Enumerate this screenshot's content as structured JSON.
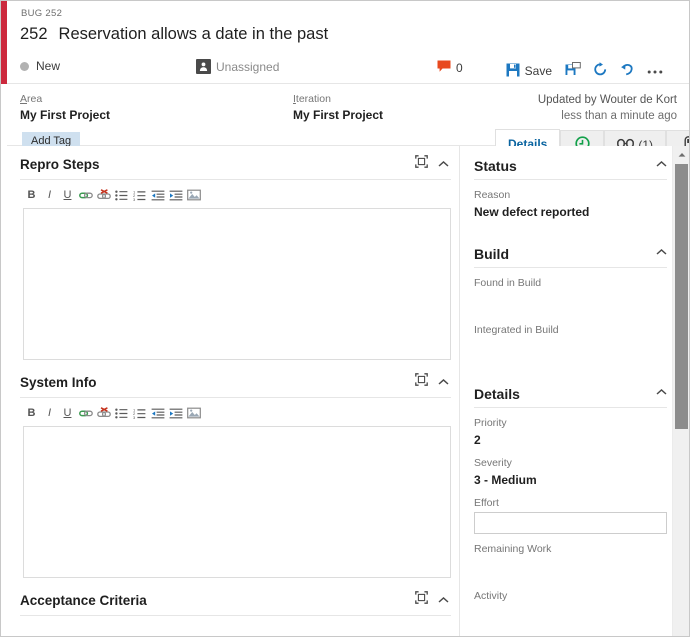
{
  "window": {
    "close_label": "×",
    "accent_color": "#cc293d"
  },
  "header": {
    "breadcrumb": "BUG 252",
    "work_item_id": "252",
    "title": "Reservation allows a date in the past",
    "state": "New",
    "assigned_to": "Unassigned",
    "discussion_count": "0",
    "toolbar": {
      "save_label": "Save",
      "save_and_close_name": "save-and-close-icon",
      "refresh_name": "refresh-icon",
      "revert_name": "undo-icon",
      "more_label": "…"
    }
  },
  "classification": {
    "area_label": "Area",
    "area_accesskey": "A",
    "area_value": "My First Project",
    "iteration_label": "Iteration",
    "iteration_accesskey": "I",
    "iteration_value": "My First Project",
    "add_tag_label": "Add Tag",
    "updated_by": "Updated by Wouter de Kort",
    "updated_when": "less than a minute ago"
  },
  "tabs": [
    {
      "label": "Details",
      "icon": "",
      "count": "",
      "selected": true
    },
    {
      "label": "",
      "icon": "history-icon",
      "count": "",
      "selected": false
    },
    {
      "label": "",
      "icon": "link-icon",
      "count": "(1)",
      "selected": false
    },
    {
      "label": "",
      "icon": "attachment-icon",
      "count": "",
      "selected": false
    }
  ],
  "rte_toolbar": [
    {
      "name": "bold-icon",
      "glyph": "B"
    },
    {
      "name": "italic-icon",
      "glyph": "I"
    },
    {
      "name": "underline-icon",
      "glyph": "U"
    },
    {
      "name": "insert-link-icon",
      "glyph": ""
    },
    {
      "name": "remove-link-icon",
      "glyph": ""
    },
    {
      "name": "bulleted-list-icon",
      "glyph": ""
    },
    {
      "name": "numbered-list-icon",
      "glyph": ""
    },
    {
      "name": "outdent-icon",
      "glyph": ""
    },
    {
      "name": "indent-icon",
      "glyph": ""
    },
    {
      "name": "insert-image-icon",
      "glyph": ""
    }
  ],
  "left_sections": [
    {
      "title": "Repro Steps",
      "has_editor": true,
      "value": ""
    },
    {
      "title": "System Info",
      "has_editor": true,
      "value": ""
    },
    {
      "title": "Acceptance Criteria",
      "has_editor": false,
      "value": ""
    }
  ],
  "right_groups": [
    {
      "title": "Status",
      "fields": [
        {
          "label": "Reason",
          "value": "New defect reported",
          "type": "text"
        }
      ]
    },
    {
      "title": "Build",
      "fields": [
        {
          "label": "Found in Build",
          "value": "",
          "type": "text"
        },
        {
          "label": "Integrated in Build",
          "value": "",
          "type": "text"
        }
      ]
    },
    {
      "title": "Details",
      "fields": [
        {
          "label": "Priority",
          "value": "2",
          "type": "text"
        },
        {
          "label": "Severity",
          "value": "3 - Medium",
          "type": "text"
        },
        {
          "label": "Effort",
          "value": "",
          "type": "input"
        },
        {
          "label": "Remaining Work",
          "value": "",
          "type": "text"
        },
        {
          "label": "Activity",
          "value": "",
          "type": "text"
        }
      ]
    }
  ],
  "scrollbar": {
    "position_percent": 0
  }
}
